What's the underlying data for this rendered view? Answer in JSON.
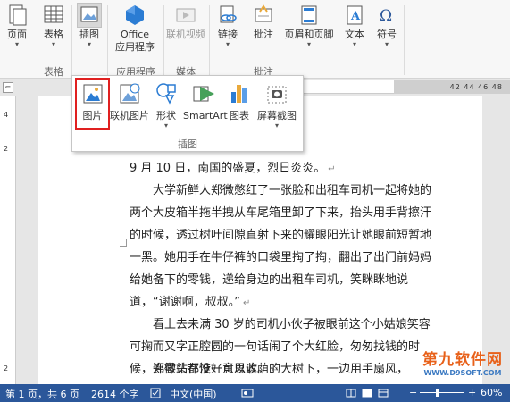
{
  "ribbon": {
    "buttons": {
      "page": "页面",
      "table": "表格",
      "illustrations": "插图",
      "office_apps_1": "Office",
      "office_apps_2": "应用程序",
      "online_video": "联机视频",
      "link": "链接",
      "comment": "批注",
      "header_footer": "页眉和页脚",
      "text": "文本",
      "symbols": "符号"
    },
    "groups": {
      "table": "表格",
      "apps": "应用程序",
      "media": "媒体",
      "comments": "批注"
    }
  },
  "gallery": {
    "items": [
      "图片",
      "联机图片",
      "形状",
      "SmartArt",
      "图表",
      "屏幕截图"
    ],
    "group_label": "插图",
    "highlight_color": "#e02020"
  },
  "ruler": {
    "top": "42   44   46   48",
    "left": [
      "4",
      "2",
      "2"
    ]
  },
  "document": {
    "lines": [
      "9 月 10 日，南国的盛夏，烈日炎炎。",
      "大学新鲜人郑微憋红了一张脸和出租车司机一起将她的两个大皮箱半拖半拽从车尾箱里卸了下来，抬头用手背擦汗的时候，透过树叶间隙直射下来的耀眼阳光让她眼前短暂地一黑。她用手在牛仔裤的口袋里掏了掏，翻出了出门前妈妈给她备下的零钱，递给身边的出租车司机，笑眯眯地说道，“谢谢啊，叔叔。”",
      "看上去未满 30 岁的司机小伙子被眼前这个小姑娘笑容可掬而又字正腔圆的一句话闹了个大红脸，匆匆找钱的时候，连零头都没好意思收。",
      "郑微站在惟一可以遮荫的大树下，一边用手扇风，"
    ],
    "para_mark": "↵"
  },
  "status": {
    "page": "第 1 页，共 6 页",
    "words": "2614 个字",
    "language": "中文(中国)",
    "minus": "−",
    "plus": "+",
    "zoom": "60%"
  },
  "watermark": {
    "main": "第九软件网",
    "sub": "WWW.D9SOFT.COM"
  },
  "colors": {
    "statusbar": "#2b579a",
    "office_blue": "#2b7cd3"
  }
}
